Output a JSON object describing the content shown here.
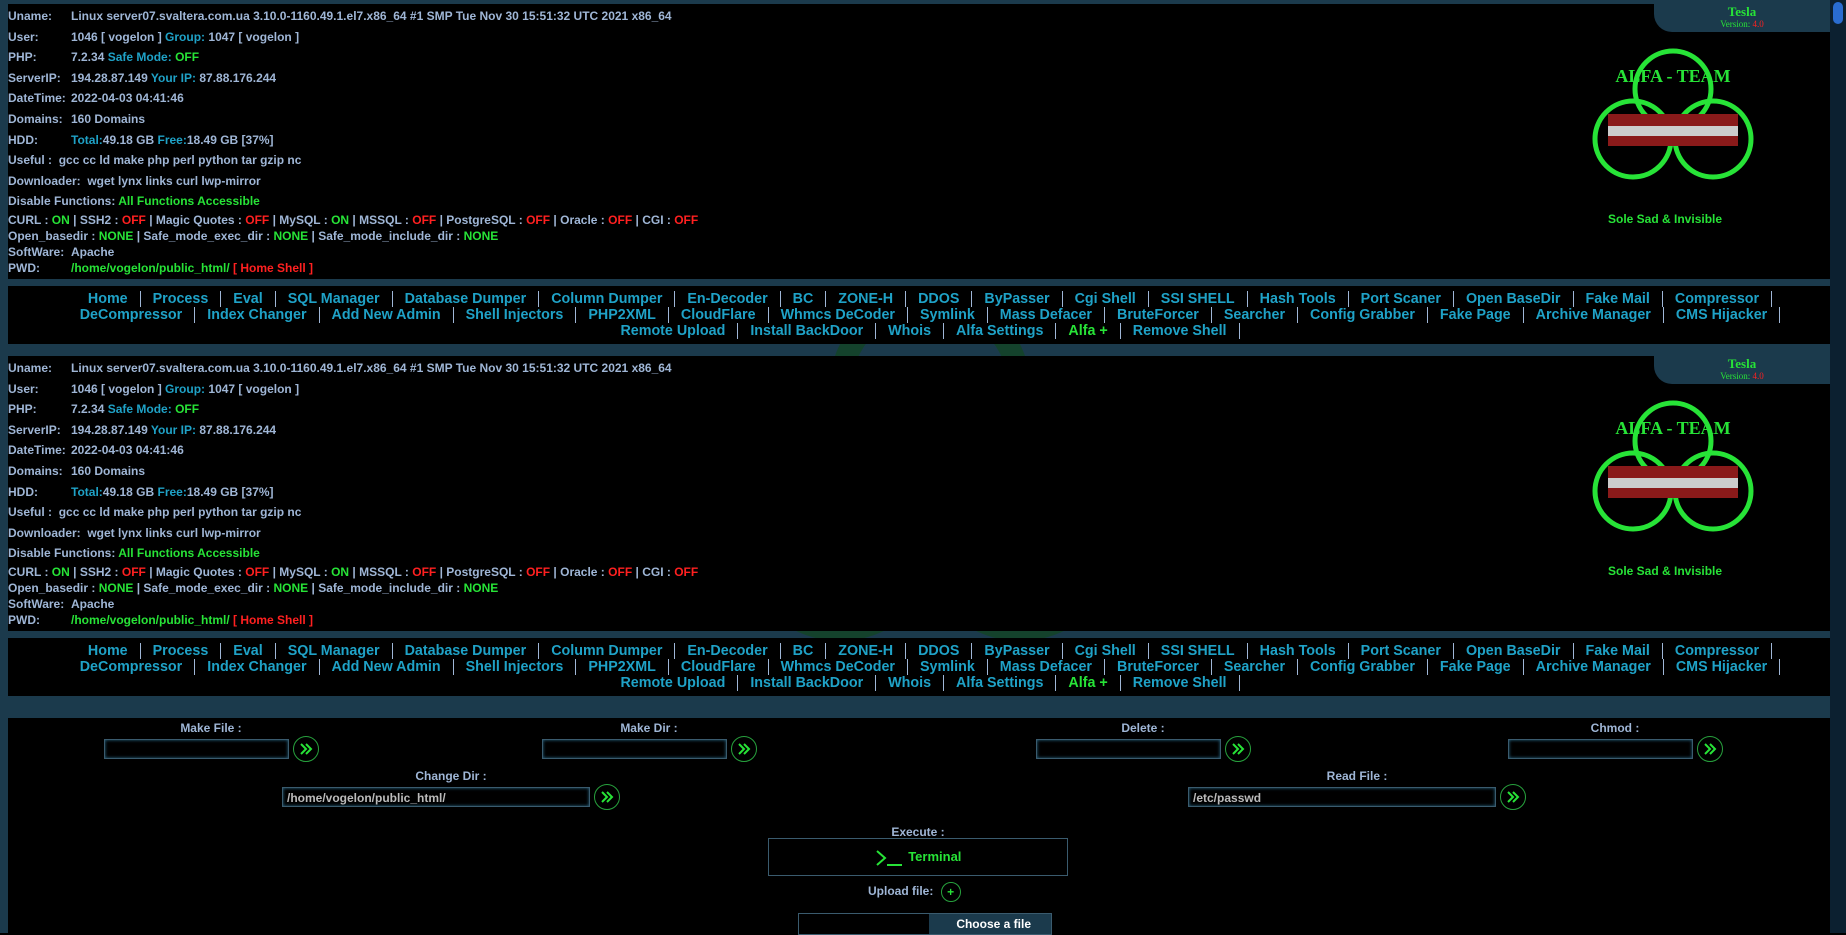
{
  "header": {
    "uname_label": "Uname:",
    "uname": "Linux server07.svaltera.com.ua 3.10.0-1160.49.1.el7.x86_64 #1 SMP Tue Nov 30 15:51:32 UTC 2021 x86_64",
    "user_label": "User:",
    "user_val": "1046 [ vogelon ]",
    "group_label": "Group:",
    "group_val": "1047 [ vogelon ]",
    "php_label": "PHP:",
    "php_version": "7.2.34",
    "safe_mode_label": "Safe Mode:",
    "safe_mode": "OFF",
    "serverip_label": "ServerIP:",
    "serverip": "194.28.87.149",
    "yourip_label": "Your IP:",
    "yourip": "87.88.176.244",
    "datetime_label": "DateTime:",
    "datetime": "2022-04-03 04:41:46",
    "domains_label": "Domains:",
    "domains": "160 Domains",
    "hdd_label": "HDD:",
    "hdd_total_label": "Total:",
    "hdd_total": "49.18 GB",
    "hdd_free_label": "Free:",
    "hdd_free": "18.49 GB [37%]",
    "useful_label": "Useful :",
    "useful": "gcc cc ld make php perl python tar gzip nc",
    "downloader_label": "Downloader:",
    "downloader": "wget lynx links curl lwp-mirror",
    "disable_label": "Disable Functions:",
    "disable": "All Functions Accessible",
    "curl_label": "CURL :",
    "curl": "ON",
    "ssh2_label": "SSH2 :",
    "ssh2": "OFF",
    "magic_label": "Magic Quotes :",
    "magic": "OFF",
    "mysql_label": "MySQL :",
    "mysql": "ON",
    "mssql_label": "MSSQL :",
    "mssql": "OFF",
    "pgsql_label": "PostgreSQL :",
    "pgsql": "OFF",
    "oracle_label": "Oracle :",
    "oracle": "OFF",
    "cgi_label": "CGI :",
    "cgi": "OFF",
    "openbasedir_label": "Open_basedir :",
    "openbasedir": "NONE",
    "safe_exec_label": "Safe_mode_exec_dir :",
    "safe_exec": "NONE",
    "safe_include_label": "Safe_mode_include_dir :",
    "safe_include": "NONE",
    "software_label": "SoftWare:",
    "software": "Apache",
    "pwd_label": "PWD:",
    "pwd": "/home/vogelon/public_html/",
    "home_shell": "[ Home Shell ]",
    "tag_name": "Tesla",
    "tag_version_label": "Version:",
    "tag_version": "4.0",
    "logo_text": "ALFA - TEAM",
    "sole": "Sole Sad & Invisible"
  },
  "menu": [
    "Home",
    "Process",
    "Eval",
    "SQL Manager",
    "Database Dumper",
    "Column Dumper",
    "En-Decoder",
    "BC",
    "ZONE-H",
    "DDOS",
    "ByPasser",
    "Cgi Shell",
    "SSI SHELL",
    "Hash Tools",
    "Port Scaner",
    "Open BaseDir",
    "Fake Mail",
    "Compressor",
    "DeCompressor",
    "Index Changer",
    "Add New Admin",
    "Shell Injectors",
    "PHP2XML",
    "CloudFlare",
    "Whmcs DeCoder",
    "Symlink",
    "Mass Defacer",
    "BruteForcer",
    "Searcher",
    "Config Grabber",
    "Fake Page",
    "Archive Manager",
    "CMS Hijacker",
    "Remote Upload",
    "Install BackDoor",
    "Whois",
    "Alfa Settings",
    "Alfa +",
    "Remove Shell"
  ],
  "tools": {
    "make_file": "Make File :",
    "make_dir": "Make Dir :",
    "delete": "Delete :",
    "chmod": "Chmod :",
    "change_dir": "Change Dir :",
    "change_dir_value": "/home/vogelon/public_html/",
    "read_file": "Read File :",
    "read_file_value": "/etc/passwd",
    "execute": "Execute :",
    "terminal": "Terminal",
    "upload_label": "Upload file:",
    "choose": "Choose a file"
  },
  "colors": {
    "on": "#27e337",
    "off": "#ff2020",
    "link": "#1fa2c7",
    "frame": "#1b3a4c"
  }
}
